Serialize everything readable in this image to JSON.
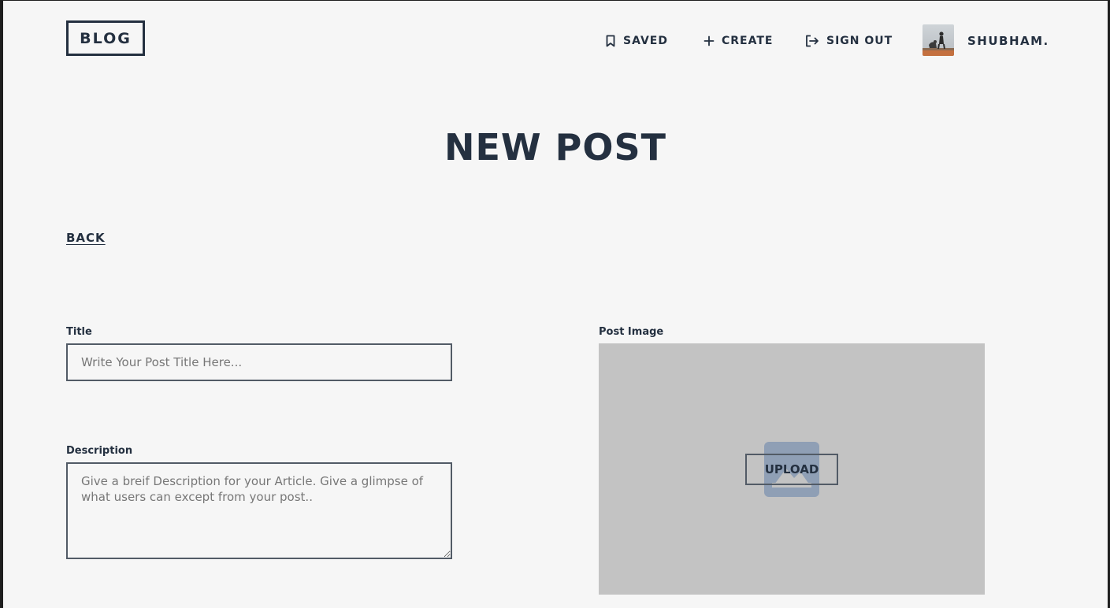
{
  "header": {
    "logo_text": "BLOG",
    "nav": {
      "saved_label": "SAVED",
      "create_label": "CREATE",
      "signout_label": "SIGN OUT"
    },
    "user_name": "SHUBHAM."
  },
  "main": {
    "page_title": "NEW POST",
    "back_label": "BACK",
    "title_field": {
      "label": "Title",
      "value": "",
      "placeholder": "Write Your Post Title Here..."
    },
    "description_field": {
      "label": "Description",
      "value": "",
      "placeholder": "Give a breif Description for your Article. Give a glimpse of what users can except from your post.."
    },
    "image_field": {
      "label": "Post Image",
      "upload_label": "UPLOAD"
    }
  },
  "colors": {
    "background": "#f6f6f6",
    "text_dark": "#243040",
    "border": "#525b66",
    "image_placeholder_bg": "#c3c3c3",
    "image_icon": "#8f9fb5"
  },
  "icons": {
    "saved": "bookmark-icon",
    "create": "plus-icon",
    "signout": "sign-out-icon",
    "image_placeholder": "image-icon"
  }
}
